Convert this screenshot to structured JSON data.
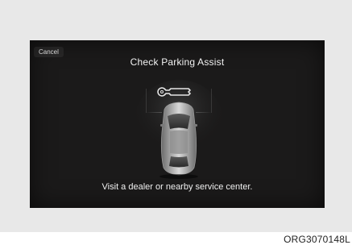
{
  "dialog": {
    "cancel_label": "Cancel",
    "title": "Check Parking Assist",
    "message": "Visit a dealer or nearby service center."
  },
  "icons": {
    "warning": "wrench-icon",
    "vehicle": "car-top-view-icon"
  },
  "figure_code": "ORG3070148L",
  "colors": {
    "screen_background": "#1b1a1a",
    "text": "#f2f2f2",
    "frame": "#e8e8e8"
  }
}
